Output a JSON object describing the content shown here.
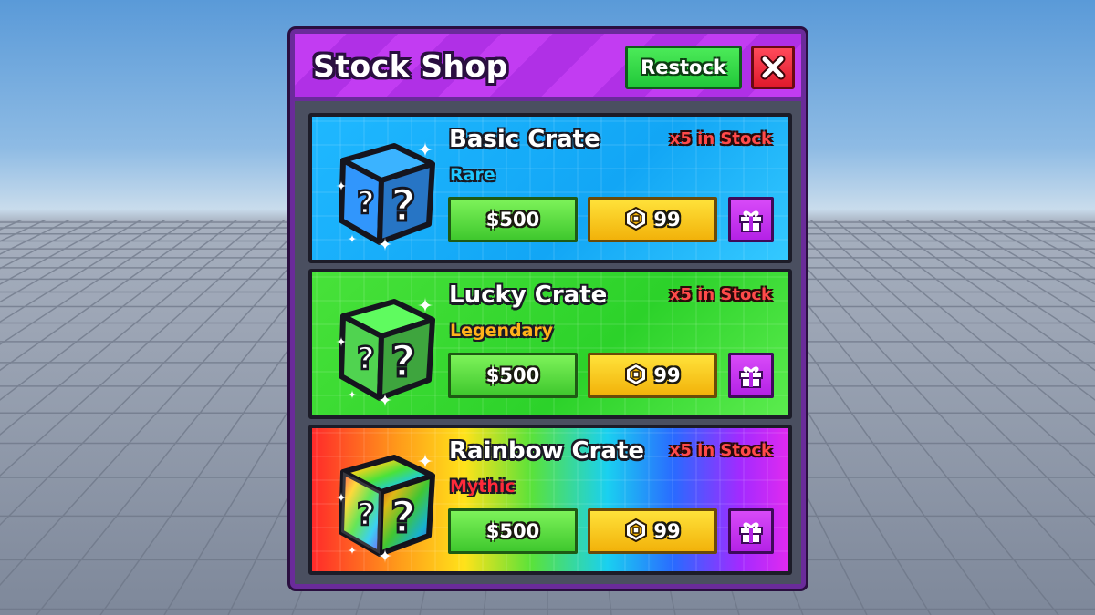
{
  "shop": {
    "title": "Stock Shop",
    "restock_label": "Restock",
    "close_icon": "close-icon"
  },
  "crates": [
    {
      "name": "Basic Crate",
      "rarity": "Rare",
      "rarity_color": "#1ec8ff",
      "stock": "x5 in Stock",
      "cash_price": "$500",
      "robux_price": "99",
      "theme": "blue",
      "cube_color": "#2f8ff0"
    },
    {
      "name": "Lucky Crate",
      "rarity": "Legendary",
      "rarity_color": "#ffb21a",
      "stock": "x5 in Stock",
      "cash_price": "$500",
      "robux_price": "99",
      "theme": "green",
      "cube_color": "#4cc94c"
    },
    {
      "name": "Rainbow Crate",
      "rarity": "Mythic",
      "rarity_color": "#ff2a3a",
      "stock": "x5 in Stock",
      "cash_price": "$500",
      "robux_price": "99",
      "theme": "rainbow",
      "cube_color": "rainbow"
    }
  ],
  "icons": {
    "crate": "mystery-crate-icon",
    "currency": "robux-icon",
    "gift": "gift-icon"
  }
}
